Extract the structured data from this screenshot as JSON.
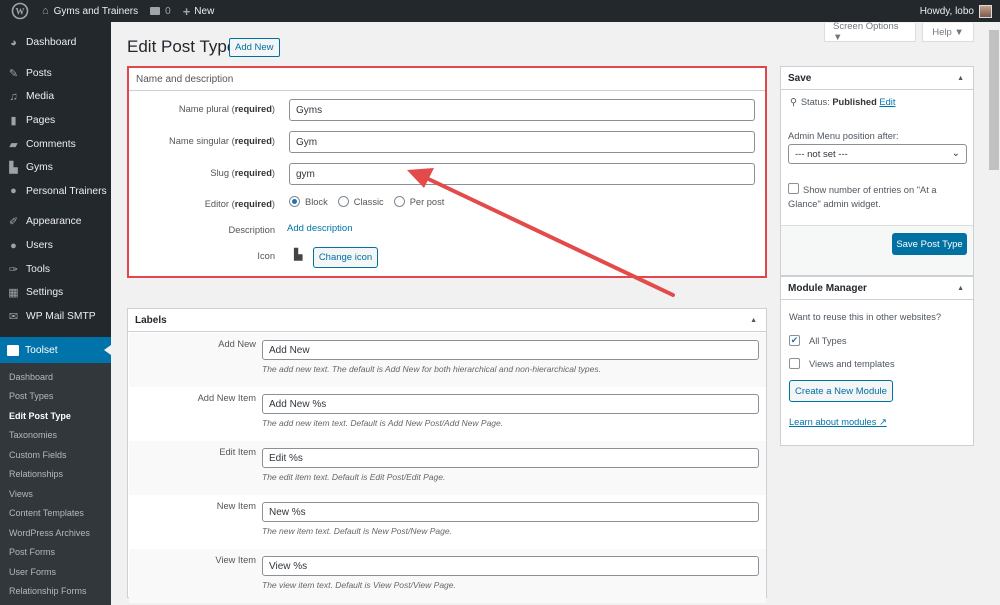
{
  "adminbar": {
    "site_name": "Gyms and Trainers",
    "comments_count": "0",
    "new_label": "New",
    "greeting": "Howdy, lobo"
  },
  "sidebar": {
    "items": [
      {
        "label": "Dashboard",
        "icon": "dashboard-icon"
      },
      {
        "label": "Posts",
        "icon": "pin-icon"
      },
      {
        "label": "Media",
        "icon": "media-icon"
      },
      {
        "label": "Pages",
        "icon": "pages-icon"
      },
      {
        "label": "Comments",
        "icon": "comment-icon"
      },
      {
        "label": "Gyms",
        "icon": "map-icon"
      },
      {
        "label": "Personal Trainers",
        "icon": "user-icon"
      },
      {
        "label": "Appearance",
        "icon": "brush-icon"
      },
      {
        "label": "Users",
        "icon": "users-icon"
      },
      {
        "label": "Tools",
        "icon": "wrench-icon"
      },
      {
        "label": "Settings",
        "icon": "settings-icon"
      },
      {
        "label": "WP Mail SMTP",
        "icon": "mail-icon"
      }
    ],
    "current": {
      "label": "Toolset",
      "icon": "toolset-icon"
    },
    "submenu": [
      "Dashboard",
      "Post Types",
      "Edit Post Type",
      "Taxonomies",
      "Custom Fields",
      "Relationships",
      "Views",
      "Content Templates",
      "WordPress Archives",
      "Post Forms",
      "User Forms",
      "Relationship Forms"
    ],
    "submenu_active": "Edit Post Type"
  },
  "screen_options": "Screen Options ▼",
  "help": "Help ▼",
  "page": {
    "title": "Edit Post Type",
    "add_new": "Add New"
  },
  "name_box": {
    "title": "Name and description",
    "required": "required",
    "fields": [
      {
        "label": "Name plural",
        "value": "Gyms"
      },
      {
        "label": "Name singular",
        "value": "Gym"
      },
      {
        "label": "Slug",
        "value": "gym"
      }
    ],
    "editor_label": "Editor",
    "editor_options": [
      "Block",
      "Classic",
      "Per post"
    ],
    "editor_selected": "Block",
    "description_label": "Description",
    "description_link": "Add description",
    "icon_label": "Icon",
    "change_icon": "Change icon"
  },
  "labels_box": {
    "title": "Labels",
    "rows": [
      {
        "label": "Add New",
        "value": "Add New",
        "desc": "The add new text. The default is Add New for both hierarchical and non-hierarchical types."
      },
      {
        "label": "Add New Item",
        "value": "Add New %s",
        "desc": "The add new item text. Default is Add New Post/Add New Page."
      },
      {
        "label": "Edit Item",
        "value": "Edit %s",
        "desc": "The edit item text. Default is Edit Post/Edit Page."
      },
      {
        "label": "New Item",
        "value": "New %s",
        "desc": "The new item text. Default is New Post/New Page."
      },
      {
        "label": "View Item",
        "value": "View %s",
        "desc": "The view item text. Default is View Post/View Page."
      }
    ]
  },
  "save_box": {
    "title": "Save",
    "status_label": "Status:",
    "status_value": "Published",
    "edit_link": "Edit",
    "menu_position_label": "Admin Menu position after:",
    "menu_position_value": "--- not set ---",
    "show_count_label": "Show number of entries on \"At a Glance\" admin widget.",
    "show_count_checked": false,
    "save_button": "Save Post Type"
  },
  "module_box": {
    "title": "Module Manager",
    "question": "Want to reuse this in other websites?",
    "options": [
      {
        "label": "All Types",
        "checked": true
      },
      {
        "label": "Views and templates",
        "checked": false
      }
    ],
    "create_button": "Create a New Module",
    "learn_link": "Learn about modules"
  },
  "colors": {
    "accent": "#0073aa",
    "highlight": "#e0474c",
    "adminbar": "#23282d"
  }
}
